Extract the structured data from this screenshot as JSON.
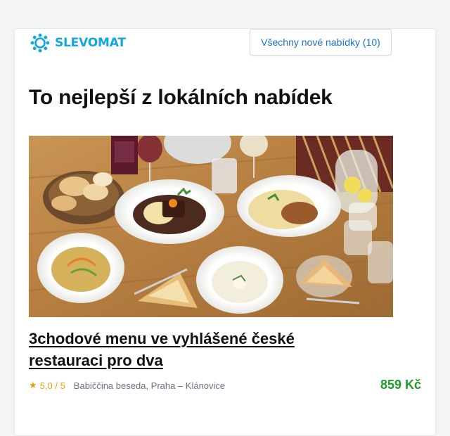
{
  "header": {
    "logo_text": "SLEVOMAT",
    "logo_icon": "gear-icon",
    "new_offers_button": "Všechny nové nabídky (10)"
  },
  "headline": "To nejlepší z lokálních nabídek",
  "offer": {
    "image_description_icon": "food-photo",
    "title": "3chodové menu ve vyhlášené české restauraci pro dva",
    "rating": "5,0 / 5",
    "location": "Babiččina beseda, Praha – Klánovice",
    "price": "859 Kč"
  },
  "colors": {
    "brand": "#12a6dc",
    "link": "#1a73c5",
    "price": "#1e9b2b",
    "star": "#e3a008"
  }
}
